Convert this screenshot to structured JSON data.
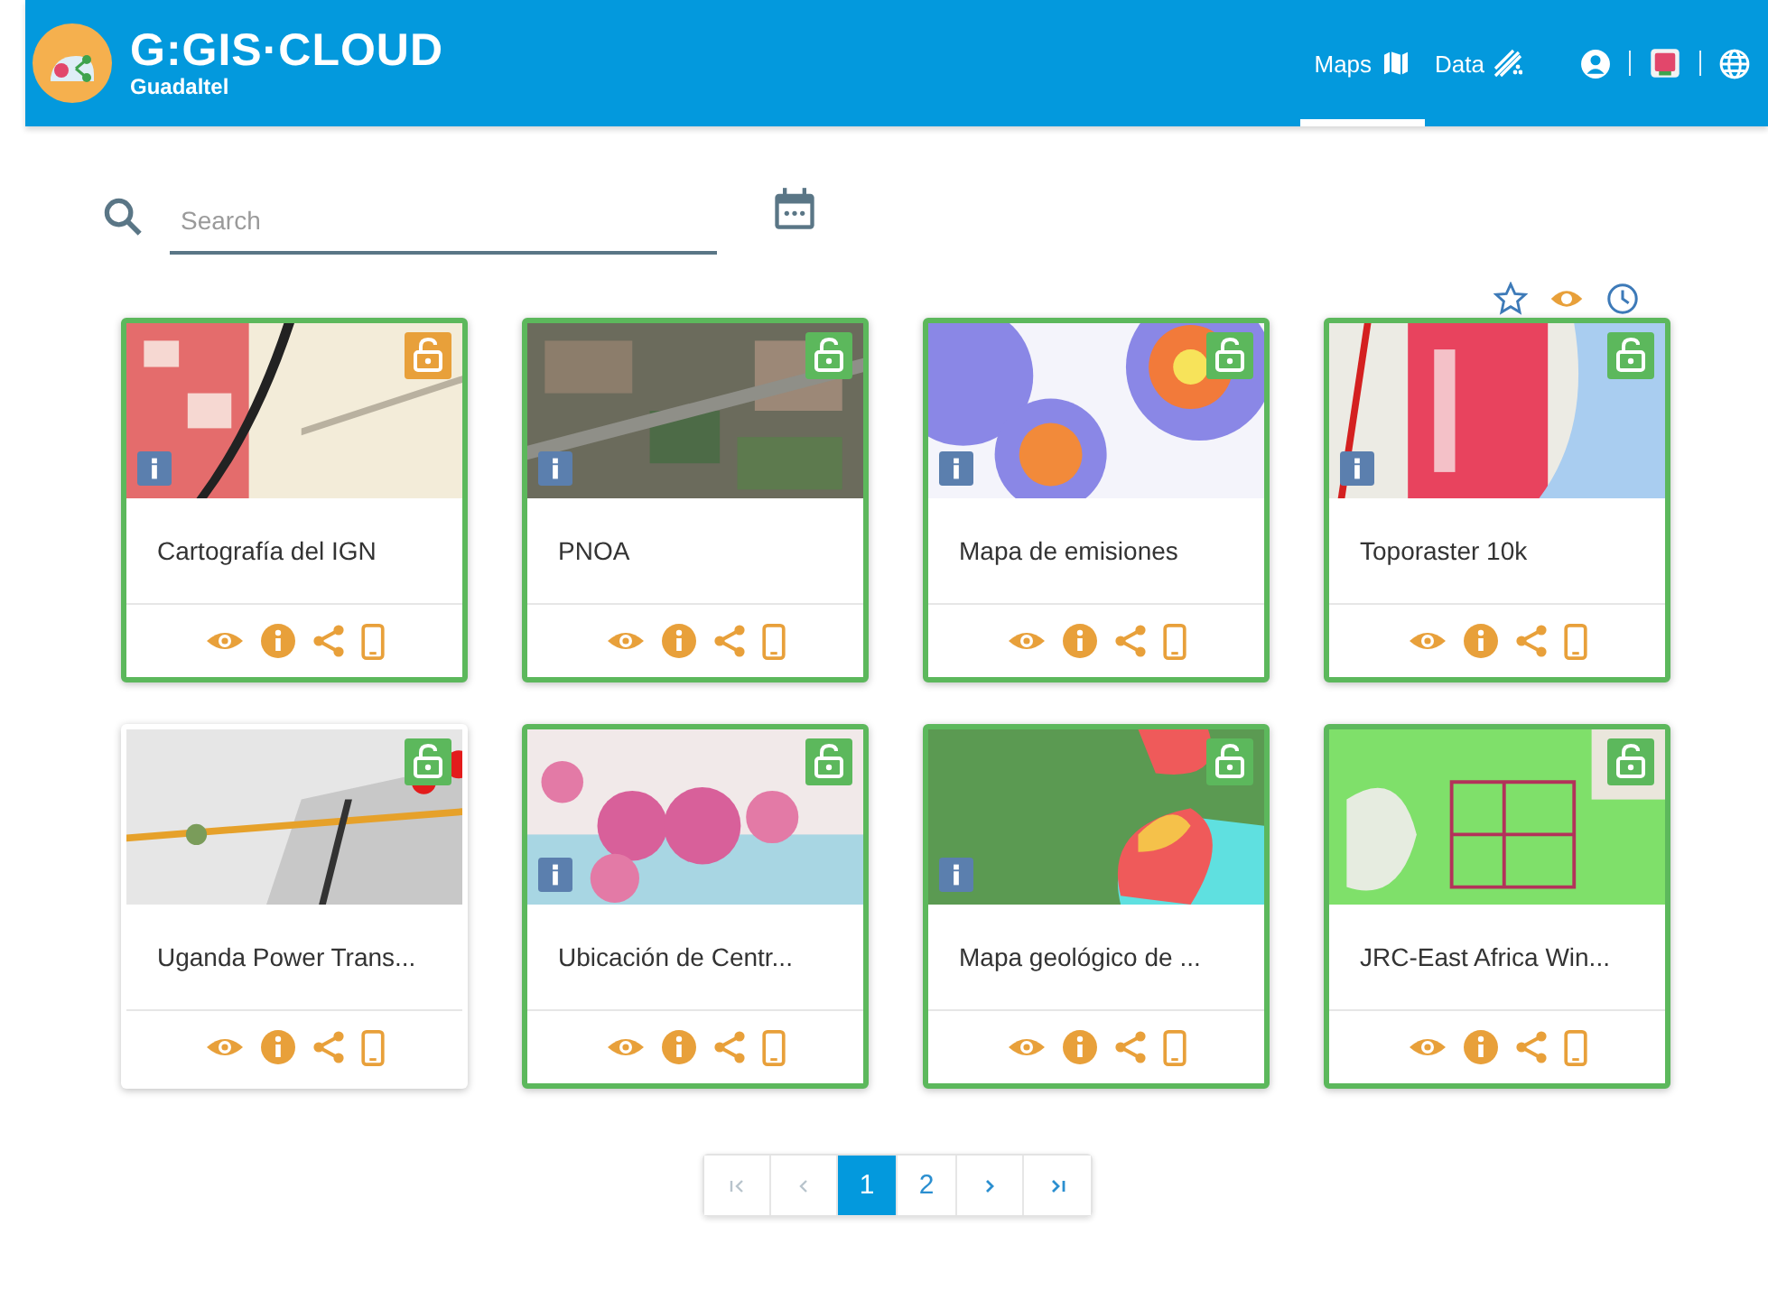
{
  "header": {
    "logo": "G:GIS·CLOUD",
    "organization": "Guadaltel",
    "tabs": [
      {
        "label": "Maps",
        "selected": true
      },
      {
        "label": "Data",
        "selected": false
      }
    ]
  },
  "search": {
    "placeholder": "Search"
  },
  "filters": [
    {
      "kind": "favorites",
      "selected": false
    },
    {
      "kind": "views",
      "selected": true
    },
    {
      "kind": "recent",
      "selected": false
    }
  ],
  "maps": [
    {
      "title": "Cartografía del IGN",
      "highlighted": true,
      "color": "#e8a03a",
      "info": true
    },
    {
      "title": "PNOA",
      "highlighted": true,
      "color": "#5cb85c",
      "info": true
    },
    {
      "title": "Mapa de emisiones",
      "highlighted": true,
      "color": "#5cb85c",
      "info": true
    },
    {
      "title": "Toporaster 10k",
      "highlighted": true,
      "color": "#5cb85c",
      "info": true
    },
    {
      "title": "Uganda Power Trans...",
      "highlighted": false,
      "color": "#5cb85c",
      "info": false
    },
    {
      "title": "Ubicación de Centr...",
      "highlighted": true,
      "color": "#5cb85c",
      "info": true
    },
    {
      "title": "Mapa geológico de ...",
      "highlighted": true,
      "color": "#5cb85c",
      "info": true
    },
    {
      "title": "JRC-East Africa Win...",
      "highlighted": true,
      "color": "#5cb85c",
      "info": false
    }
  ],
  "pagination": {
    "pages": [
      {
        "label": "1",
        "selected": true
      },
      {
        "label": "2",
        "selected": false
      }
    ]
  }
}
